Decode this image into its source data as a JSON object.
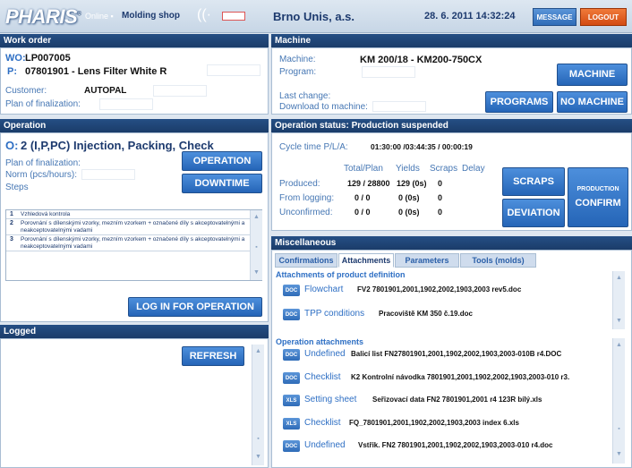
{
  "app": {
    "logo": "PHARIS",
    "online_label": "Online",
    "shop": "Molding shop",
    "company": "Brno Unis, a.s.",
    "datetime": "28. 6. 2011 14:32:24",
    "message_button": "MESSAGE",
    "logout_button": "LOGOUT"
  },
  "work_order": {
    "header": "Work order",
    "wo_label": "WO:",
    "wo_value": "LP007005",
    "p_label": "P:",
    "p_value": "07801901 - Lens Filter White R",
    "customer_label": "Customer:",
    "customer_value": "AUTOPAL",
    "plan_label": "Plan of finalization:"
  },
  "machine": {
    "header": "Machine",
    "machine_label": "Machine:",
    "machine_value": "KM 200/18 - KM200-750CX",
    "program_label": "Program:",
    "last_change_label": "Last change:",
    "download_label": "Download to machine:",
    "machine_button": "MACHINE",
    "programs_button": "PROGRAMS",
    "no_machine_button": "NO MACHINE"
  },
  "operation": {
    "header": "Operation",
    "title_prefix": "O:",
    "title": "2 (I,P,PC) Injection, Packing, Check",
    "plan_label": "Plan of finalization:",
    "norm_label": "Norm (pcs/hours):",
    "steps_label": "Steps",
    "operation_button": "OPERATION",
    "downtime_button": "DOWNTIME",
    "login_button": "LOG IN FOR OPERATION",
    "steps": [
      {
        "n": "1",
        "text": "Vzhledová kontrola"
      },
      {
        "n": "2",
        "text": "Porovnání s dílenskými vzorky, mezním vzorkem + označené díly s akceptovatelnými a neakceptovatelnými vadami"
      },
      {
        "n": "3",
        "text": "Porovnání s dílenskými vzorky, mezním vzorkem + označené díly s akceptovatelnými a neakceptovatelnými vadami"
      }
    ]
  },
  "status": {
    "header": "Operation status: Production suspended",
    "cycle_label": "Cycle time P/L/A:",
    "cycle_value": "01:30:00 /03:44:35 / 00:00:19",
    "col_total": "Total/Plan",
    "col_yields": "Yields",
    "col_scraps": "Scraps",
    "col_delay": "Delay",
    "rows": [
      {
        "label": "Produced:",
        "total": "129 / 28800",
        "yields": "129 (0s)",
        "scraps": "0"
      },
      {
        "label": "From logging:",
        "total": "0 / 0",
        "yields": "0 (0s)",
        "scraps": "0"
      },
      {
        "label": "Unconfirmed:",
        "total": "0 / 0",
        "yields": "0 (0s)",
        "scraps": "0"
      }
    ],
    "scraps_button": "SCRAPS",
    "deviation_button": "DEVIATION",
    "production_label": "PRODUCTION",
    "confirm_label": "CONFIRM"
  },
  "misc": {
    "header": "Miscellaneous",
    "tabs": [
      "Confirmations",
      "Attachments",
      "Parameters",
      "Tools (molds)"
    ],
    "active_tab": "Attachments",
    "product_section": "Attachments of product definition",
    "operation_section": "Operation attachments",
    "product_attachments": [
      {
        "icon": "DOC",
        "type": "Flowchart",
        "file": "FV2 7801901,2001,1902,2002,1903,2003 rev5.doc"
      },
      {
        "icon": "DOC",
        "type": "TPP conditions",
        "file": "Pracoviště KM 350 č.19.doc"
      }
    ],
    "operation_attachments": [
      {
        "icon": "DOC",
        "type": "Undefined",
        "file": "Balicí list FN27801901,2001,1902,2002,1903,2003-010B r4.DOC"
      },
      {
        "icon": "DOC",
        "type": "Checklist",
        "file": "K2 Kontrolní návodka 7801901,2001,1902,2002,1903,2003-010 r3."
      },
      {
        "icon": "XLS",
        "type": "Setting sheet",
        "file": "Seřizovací data FN2 7801901,2001 r4 123R bílý.xls"
      },
      {
        "icon": "XLS",
        "type": "Checklist",
        "file": "FQ_7801901,2001,1902,2002,1903,2003 index 6.xls"
      },
      {
        "icon": "DOC",
        "type": "Undefined",
        "file": "Vstřik. FN2 7801901,2001,1902,2002,1903,2003-010 r4.doc"
      }
    ]
  },
  "logged": {
    "header": "Logged",
    "refresh_button": "REFRESH"
  },
  "colors": {
    "header_bg": "#1b3c69",
    "button_blue": "#2f6cb8",
    "logout_orange": "#d34a12",
    "label_blue": "#4677b4"
  }
}
